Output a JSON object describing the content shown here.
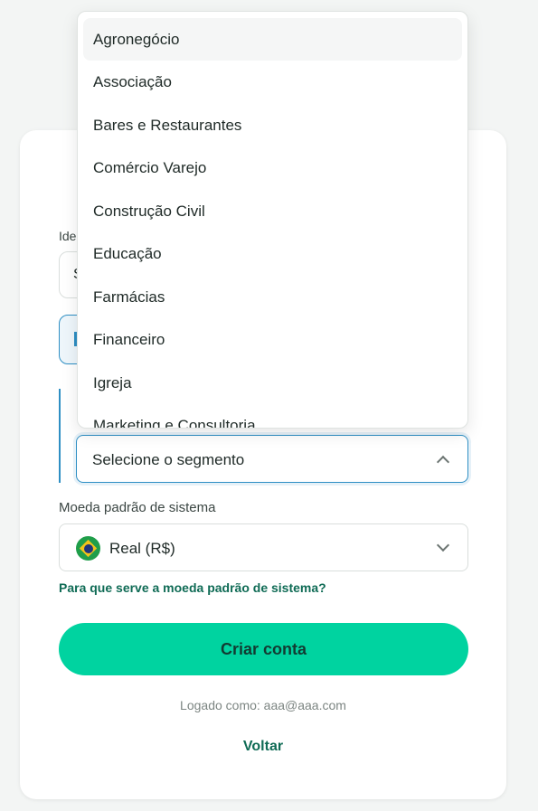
{
  "background_form": {
    "partial_label": "Ide",
    "partial_input_value": "S"
  },
  "segment_select": {
    "placeholder": "Selecione o segmento",
    "options": [
      "Agronegócio",
      "Associação",
      "Bares e Restaurantes",
      "Comércio Varejo",
      "Construção Civil",
      "Educação",
      "Farmácias",
      "Financeiro",
      "Igreja",
      "Marketing e Consultoria"
    ],
    "highlighted_option": "Agronegócio"
  },
  "currency": {
    "label": "Moeda padrão de sistema",
    "selected": "Real (R$)",
    "flag_icon": "brazil-flag-icon",
    "help_link": "Para que serve a moeda padrão de sistema?"
  },
  "actions": {
    "create_account": "Criar conta",
    "logged_in_as": "Logado como: aaa@aaa.com",
    "back": "Voltar"
  },
  "colors": {
    "accent_green": "#00d3a0",
    "link_green": "#0f6b55",
    "focus_blue": "#2e8fc4"
  }
}
